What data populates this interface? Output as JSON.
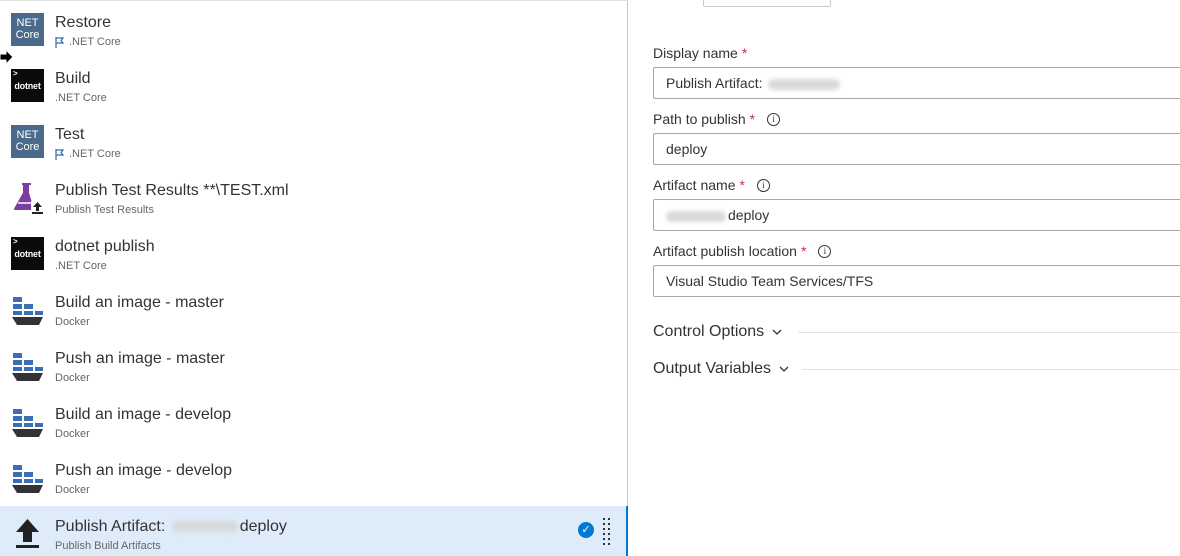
{
  "tasks": [
    {
      "title": "Restore",
      "subtitle": ".NET Core",
      "icon": "net-core-icon",
      "icon_text_1": "NET",
      "icon_text_2": "Core",
      "flag": true
    },
    {
      "title": "Build",
      "subtitle": ".NET Core",
      "icon": "dotnet-icon",
      "icon_text_1": "dotnet",
      "flag": false
    },
    {
      "title": "Test",
      "subtitle": ".NET Core",
      "icon": "net-core-icon",
      "icon_text_1": "NET",
      "icon_text_2": "Core",
      "flag": true
    },
    {
      "title": "Publish Test Results **\\TEST.xml",
      "subtitle": "Publish Test Results",
      "icon": "flask-upload-icon",
      "flag": false
    },
    {
      "title": "dotnet publish",
      "subtitle": ".NET Core",
      "icon": "dotnet-icon",
      "icon_text_1": "dotnet",
      "flag": false
    },
    {
      "title": "Build an image - master",
      "subtitle": "Docker",
      "icon": "docker-icon",
      "flag": false
    },
    {
      "title": "Push an image - master",
      "subtitle": "Docker",
      "icon": "docker-icon",
      "flag": false
    },
    {
      "title": "Build an image - develop",
      "subtitle": "Docker",
      "icon": "docker-icon",
      "flag": false
    },
    {
      "title": "Push an image - develop",
      "subtitle": "Docker",
      "icon": "docker-icon",
      "flag": false
    },
    {
      "title_prefix": "Publish Artifact: ",
      "title_suffix": "deploy",
      "subtitle": "Publish Build Artifacts",
      "icon": "upload-arrow-icon",
      "selected": true
    }
  ],
  "form": {
    "display_name": {
      "label": "Display name",
      "required": "*",
      "value_prefix": "Publish Artifact:"
    },
    "path_to_publish": {
      "label": "Path to publish",
      "required": "*",
      "info": "i",
      "value": "deploy"
    },
    "artifact_name": {
      "label": "Artifact name",
      "required": "*",
      "info": "i",
      "value_suffix": "deploy"
    },
    "artifact_publish_location": {
      "label": "Artifact publish location",
      "required": "*",
      "info": "i",
      "value": "Visual Studio Team Services/TFS"
    },
    "control_options": "Control Options",
    "output_variables": "Output Variables"
  },
  "colors": {
    "accent": "#0078d4",
    "selected_bg": "#deecf9",
    "required": "#c4314b"
  }
}
